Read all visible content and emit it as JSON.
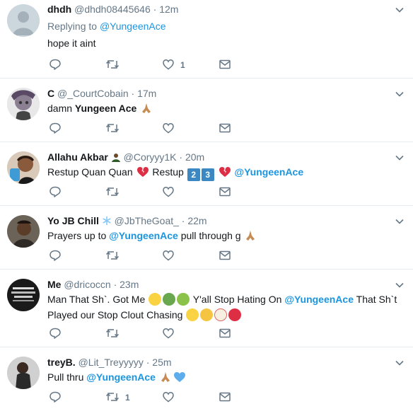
{
  "tweets": [
    {
      "name": "dhdh",
      "handle": "@dhdh08445646",
      "time": "12m",
      "replying_prefix": "Replying to ",
      "replying_to": "@YungeenAce",
      "text": "hope it aint",
      "replies": "",
      "retweets": "",
      "likes": "1"
    },
    {
      "name": "C",
      "handle": "@_CourtCobain",
      "time": "17m",
      "text_prefix": "damn ",
      "text_bold": "Yungeen Ace",
      "replies": "",
      "retweets": "",
      "likes": ""
    },
    {
      "name": "Allahu Akbar",
      "handle": "@Coryyy1K",
      "time": "20m",
      "text_a": "Restup Quan Quan",
      "text_b": "Restup",
      "key1": "2",
      "key2": "3",
      "mention": "@YungeenAce",
      "replies": "",
      "retweets": "",
      "likes": ""
    },
    {
      "name": "Yo JB Chill",
      "handle": "@JbTheGoat_",
      "time": "22m",
      "text_prefix": "Prayers up to ",
      "mention": "@YungeenAce",
      "text_suffix": " pull through g",
      "replies": "",
      "retweets": "",
      "likes": ""
    },
    {
      "name": "Me",
      "handle": "@dricoccn",
      "time": "23m",
      "line1_a": "Man That Sh`. Got Me",
      "line1_b": "Y'all Stop Hating On",
      "mention": "@YungeenAce",
      "line1_c": "That Sh`t",
      "line2": "Played our Stop Clout Chasing",
      "replies": "",
      "retweets": "",
      "likes": ""
    },
    {
      "name": "treyB.",
      "handle": "@Lit_Treyyyyy",
      "time": "25m",
      "text_prefix": "Pull thru ",
      "mention": "@YungeenAce",
      "replies": "",
      "retweets": "1",
      "likes": ""
    }
  ],
  "dot": "·",
  "icons": {
    "reply": "reply-icon",
    "retweet": "retweet-icon",
    "like": "heart-icon",
    "dm": "envelope-icon",
    "caret": "chevron-down-icon"
  },
  "colors": {
    "link": "#1b95e0",
    "muted": "#657786",
    "text": "#14171a",
    "divider": "#e6ecf0"
  }
}
